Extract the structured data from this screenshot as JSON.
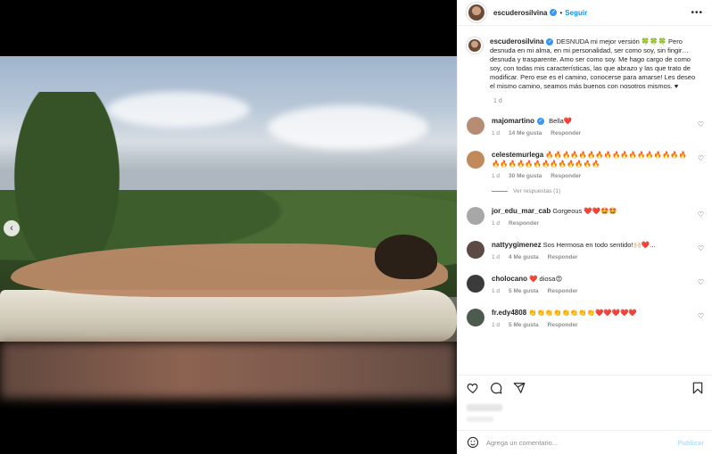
{
  "post": {
    "username": "escuderosilvina",
    "follow_label": "Seguir",
    "more_label": "•••"
  },
  "caption": {
    "username": "escuderosilvina",
    "text": "DESNUDA mi mejor versión 🍀🍀🍀 Pero desnuda en mi alma, en mi personalidad, ser como soy, sin fingir… desnuda y trasparente. Amo ser como soy. Me hago cargo de como soy, con todas mis características, las que abrazo y las que trato de modificar. Pero ese es el camino, conocerse para amarse! Les deseo el mismo camino, seamos más buenos con nosotros mismos. ♥",
    "time": "1 d"
  },
  "comments": [
    {
      "username": "majomartino",
      "text": "Bella❤️",
      "time": "1 d",
      "likes": "14 Me gusta",
      "reply": "Responder",
      "avatar_color": "#b68d74"
    },
    {
      "username": "celestemurlega",
      "text": "🔥🔥🔥🔥🔥🔥🔥🔥🔥🔥🔥🔥🔥🔥🔥🔥🔥🔥🔥🔥🔥🔥🔥🔥🔥🔥🔥🔥🔥🔥",
      "time": "1 d",
      "likes": "30 Me gusta",
      "reply": "Responder",
      "avatar_color": "#c28a5b",
      "view_replies": "Ver respuestas (1)"
    },
    {
      "username": "jor_edu_mar_cab",
      "text": "Gorgeous ❤️❤️🤩🤩",
      "time": "1 d",
      "likes": "",
      "reply": "Responder",
      "avatar_color": "#a7a7a7"
    },
    {
      "username": "nattyygimenez",
      "text": "Sos Hermosa en todo sentido!🙌🏻❤️...",
      "time": "1 d",
      "likes": "4 Me gusta",
      "reply": "Responder",
      "avatar_color": "#5b4b44"
    },
    {
      "username": "cholocano",
      "text": "❤️ diosa😍",
      "time": "1 d",
      "likes": "5 Me gusta",
      "reply": "Responder",
      "avatar_color": "#3b3b3b"
    },
    {
      "username": "fr.edy4808",
      "text": "👏👏👏👏👏👏👏👏❤️❤️❤️❤️❤️",
      "time": "1 d",
      "likes": "5 Me gusta",
      "reply": "Responder",
      "avatar_color": "#4d5a4e"
    }
  ],
  "add_comment": {
    "placeholder": "Agrega un comentario...",
    "publish_label": "Publicar"
  },
  "icons": {
    "like": "heart-icon",
    "comment": "comment-icon",
    "share": "share-icon",
    "save": "bookmark-icon",
    "emoji": "emoji-icon"
  },
  "colors": {
    "accent": "#0095f6",
    "verified": "#3897f0",
    "muted": "#8e8e8e"
  }
}
